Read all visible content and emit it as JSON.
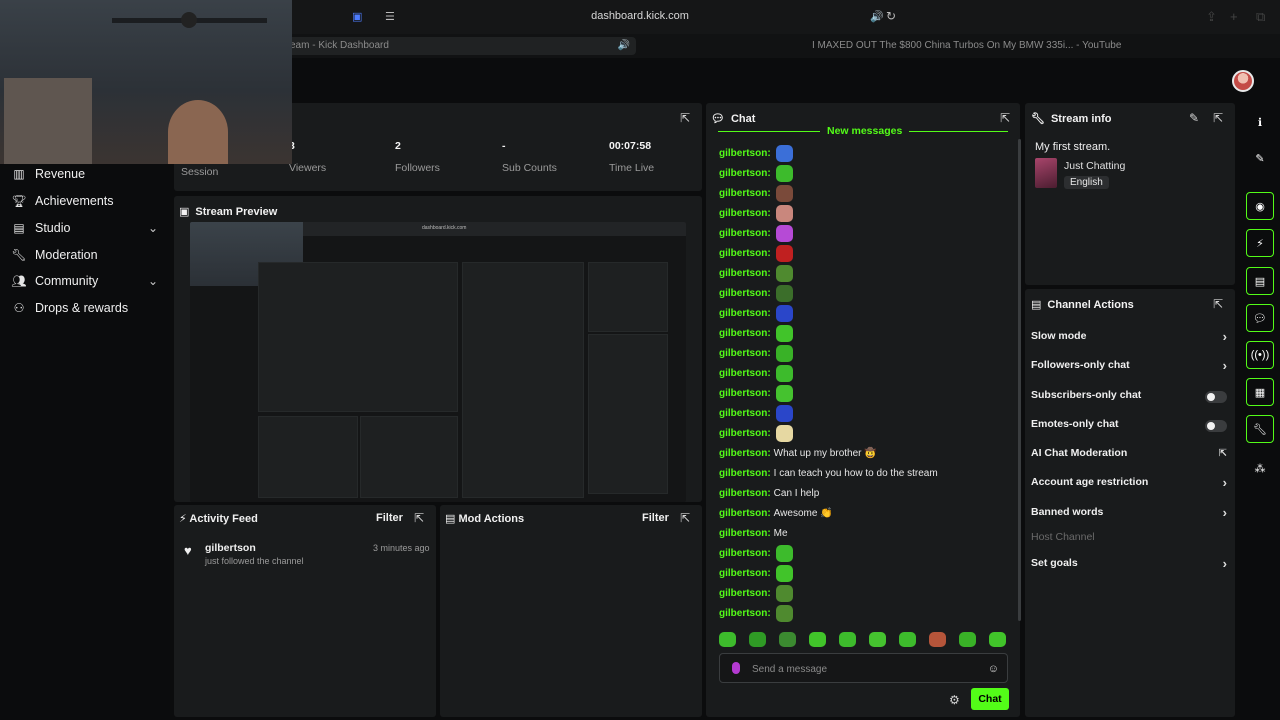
{
  "browser": {
    "url": "dashboard.kick.com",
    "tabs": [
      {
        "title": "eam - Kick Dashboard"
      },
      {
        "title": "I MAXED OUT The $800 China Turbos On My BMW 335i... - YouTube"
      }
    ]
  },
  "sidebar": {
    "items": [
      {
        "label": "Revenue",
        "icon": "revenue-icon"
      },
      {
        "label": "Achievements",
        "icon": "trophy-icon"
      },
      {
        "label": "Studio",
        "icon": "studio-icon"
      },
      {
        "label": "Moderation",
        "icon": "wrench-icon"
      },
      {
        "label": "Community",
        "icon": "community-icon"
      },
      {
        "label": "Drops & rewards",
        "icon": "gift-icon"
      }
    ]
  },
  "stats": {
    "session_label": "Session",
    "viewers_value": "3",
    "viewers_label": "Viewers",
    "followers_value": "2",
    "followers_label": "Followers",
    "subs_value": "-",
    "subs_label": "Sub Counts",
    "time_value": "00:07:58",
    "time_label": "Time Live"
  },
  "preview": {
    "title": "Stream Preview"
  },
  "activity": {
    "title": "Activity Feed",
    "filter": "Filter",
    "items": [
      {
        "user": "gilbertson",
        "text": "just followed the channel",
        "time": "3 minutes ago"
      }
    ]
  },
  "mod_actions": {
    "title": "Mod Actions",
    "filter": "Filter"
  },
  "chat": {
    "title": "Chat",
    "new_messages": "New messages",
    "messages": [
      {
        "user": "gilbertson:",
        "text": "",
        "emote": "#3b6fd8"
      },
      {
        "user": "gilbertson:",
        "text": "",
        "emote": "#3dbb2c"
      },
      {
        "user": "gilbertson:",
        "text": "",
        "emote": "#7a4a3a"
      },
      {
        "user": "gilbertson:",
        "text": "",
        "emote": "#c9877d"
      },
      {
        "user": "gilbertson:",
        "text": "",
        "emote": "#b64ad6"
      },
      {
        "user": "gilbertson:",
        "text": "",
        "emote": "#c02020"
      },
      {
        "user": "gilbertson:",
        "text": "",
        "emote": "#4f8a2f"
      },
      {
        "user": "gilbertson:",
        "text": "",
        "emote": "#3b6e2a"
      },
      {
        "user": "gilbertson:",
        "text": "",
        "emote": "#2a46c9"
      },
      {
        "user": "gilbertson:",
        "text": "",
        "emote": "#41c42a"
      },
      {
        "user": "gilbertson:",
        "text": "",
        "emote": "#39b227"
      },
      {
        "user": "gilbertson:",
        "text": "",
        "emote": "#3dbb2c"
      },
      {
        "user": "gilbertson:",
        "text": "",
        "emote": "#45c22f"
      },
      {
        "user": "gilbertson:",
        "text": "",
        "emote": "#2a46c9"
      },
      {
        "user": "gilbertson:",
        "text": "",
        "emote": "#e6d8a2"
      },
      {
        "user": "gilbertson:",
        "text": "What up my brother 🤠",
        "emote": ""
      },
      {
        "user": "gilbertson:",
        "text": "I can teach you how to do the stream",
        "emote": ""
      },
      {
        "user": "gilbertson:",
        "text": "Can I help",
        "emote": ""
      },
      {
        "user": "gilbertson:",
        "text": "Awesome 👏",
        "emote": ""
      },
      {
        "user": "gilbertson:",
        "text": "Me",
        "emote": ""
      },
      {
        "user": "gilbertson:",
        "text": "",
        "emote": "#3dbb2c"
      },
      {
        "user": "gilbertson:",
        "text": "",
        "emote": "#41c42a"
      },
      {
        "user": "gilbertson:",
        "text": "",
        "emote": "#4f8a2f"
      },
      {
        "user": "gilbertson:",
        "text": "",
        "emote": "#4f8a2f"
      }
    ],
    "emote_bar": [
      "#3dbb2c",
      "#2f9a25",
      "#3b8a30",
      "#41c42a",
      "#3dbb2c",
      "#45c22f",
      "#3dbb2c",
      "#b5553a",
      "#39b227",
      "#41c42a"
    ],
    "input_placeholder": "Send a message",
    "send_label": "Chat"
  },
  "stream_info": {
    "title": "Stream info",
    "stream_title": "My first stream.",
    "category": "Just Chatting",
    "language": "English"
  },
  "channel_actions": {
    "title": "Channel Actions",
    "items": [
      {
        "label": "Slow mode",
        "control": "arrow"
      },
      {
        "label": "Followers-only chat",
        "control": "arrow"
      },
      {
        "label": "Subscribers-only chat",
        "control": "toggle"
      },
      {
        "label": "Emotes-only chat",
        "control": "toggle"
      },
      {
        "label": "AI Chat Moderation",
        "control": "external"
      },
      {
        "label": "Account age restriction",
        "control": "arrow"
      },
      {
        "label": "Banned words",
        "control": "arrow"
      },
      {
        "label": "Host Channel",
        "control": "none"
      },
      {
        "label": "Set goals",
        "control": "arrow"
      }
    ]
  },
  "colors": {
    "accent": "#53fc18",
    "panel": "#191b1c",
    "background": "#0b0c0d"
  }
}
